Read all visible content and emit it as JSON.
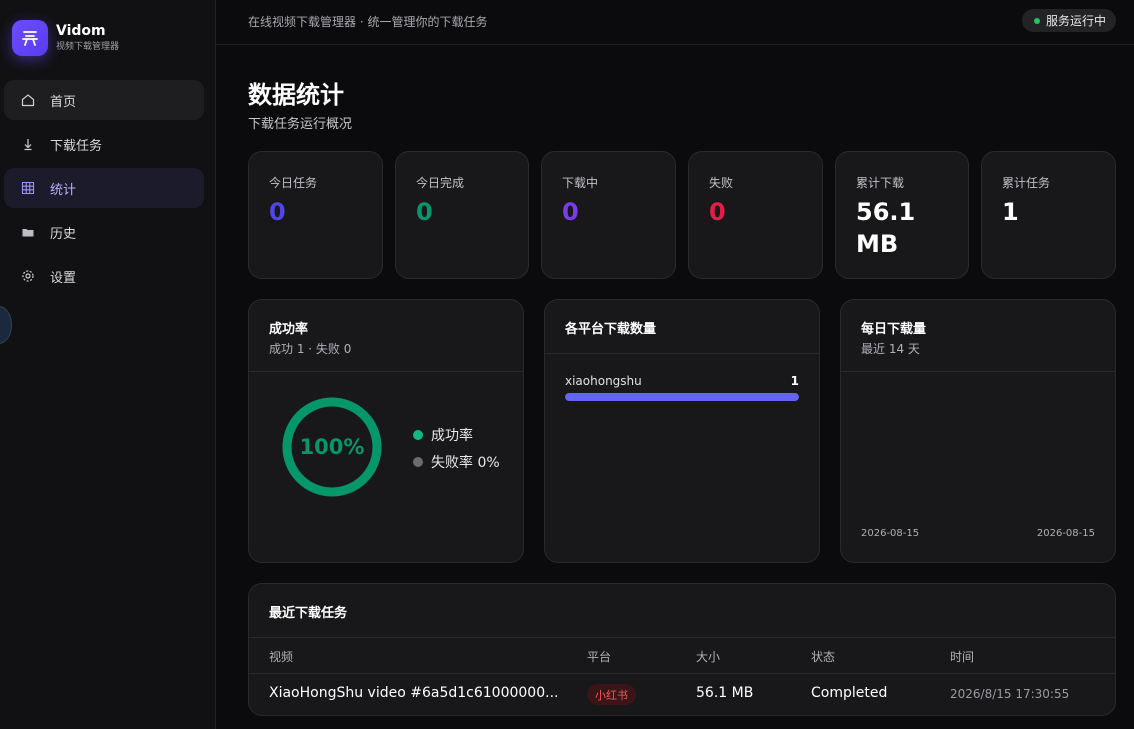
{
  "app": {
    "name": "Vidom",
    "subtitle": "视频下载管理器",
    "logo_char": "兲"
  },
  "nav": [
    {
      "label": "首页",
      "icon": "home-icon"
    },
    {
      "label": "下载任务",
      "icon": "download-icon"
    },
    {
      "label": "统计",
      "icon": "grid-chart-icon"
    },
    {
      "label": "历史",
      "icon": "history-icon"
    },
    {
      "label": "设置",
      "icon": "gear-icon"
    }
  ],
  "topbar": {
    "tagline": "在线视频下载管理器 · 统一管理你的下载任务",
    "status": "服务运行中"
  },
  "page": {
    "title": "数据统计",
    "subtitle": "下载任务运行概况"
  },
  "stats": [
    {
      "label": "今日任务",
      "value": "0",
      "color": "#4f46e5"
    },
    {
      "label": "今日完成",
      "value": "0",
      "color": "#059669"
    },
    {
      "label": "下载中",
      "value": "0",
      "color": "#7c3aed"
    },
    {
      "label": "失败",
      "value": "0",
      "color": "#e11d48"
    },
    {
      "label": "累计下载",
      "value": "56.1 MB",
      "color": "#ffffff"
    },
    {
      "label": "累计任务",
      "value": "1",
      "color": "#ffffff"
    }
  ],
  "success_panel": {
    "title": "成功率",
    "subtitle": "成功 1 · 失败 0",
    "rate_text": "100%",
    "rate": 1.0,
    "legend": [
      {
        "label": "成功率",
        "color": "#10b981"
      },
      {
        "label": "失败率 0%",
        "color": "#6b6b72"
      }
    ]
  },
  "platform_panel": {
    "title": "各平台下载数量",
    "items": [
      {
        "name": "xiaohongshu",
        "count": "1",
        "share": 1.0
      }
    ]
  },
  "daily_panel": {
    "title": "每日下载量",
    "subtitle": "最近 14 天",
    "start_date": "2026-08-15",
    "end_date": "2026-08-15"
  },
  "recent": {
    "title": "最近下载任务",
    "columns": [
      "视频",
      "平台",
      "大小",
      "状态",
      "时间"
    ],
    "rows": [
      {
        "video": "XiaoHongShu video #6a5d1c61000000...",
        "platform": "小红书",
        "size": "56.1 MB",
        "status": "Completed",
        "time": "2026/8/15 17:30:55"
      }
    ]
  }
}
